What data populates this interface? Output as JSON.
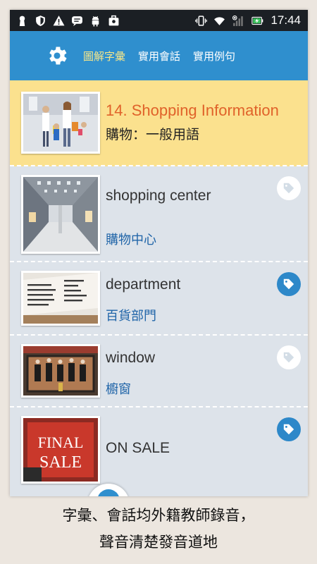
{
  "status_bar": {
    "time": "17:44",
    "left_icons": [
      "keyhole-icon",
      "shield-icon",
      "warning-icon",
      "chat-icon",
      "android-icon",
      "bag-icon"
    ],
    "right_icons": [
      "vibrate-icon",
      "wifi-icon",
      "signal-icon",
      "battery-charging-icon"
    ]
  },
  "appbar": {
    "tabs": [
      {
        "label": "圖解字彙"
      },
      {
        "label": "實用會話"
      },
      {
        "label": "實用例句"
      }
    ],
    "active_color": "#f6e68a"
  },
  "header": {
    "title": "14. Shopping Information",
    "subtitle": "購物：一般用語"
  },
  "items": [
    {
      "word": "shopping center",
      "translation": "購物中心",
      "tagged": false
    },
    {
      "word": "department",
      "translation": "百貨部門",
      "tagged": true
    },
    {
      "word": "window",
      "translation": "櫥窗",
      "tagged": false
    },
    {
      "word": "ON SALE",
      "translation": "",
      "tagged": true
    }
  ],
  "sale_sign": {
    "line1": "FINAL",
    "line2": "SALE"
  },
  "caption": {
    "line1": "字彙、會話均外籍教師錄音，",
    "line2": "聲音清楚發音道地"
  },
  "colors": {
    "appbar": "#2f8fce",
    "header_bg": "#fbe18e",
    "title": "#e0622a",
    "translation": "#1f64a8",
    "tag_on": "#2d88c9"
  }
}
